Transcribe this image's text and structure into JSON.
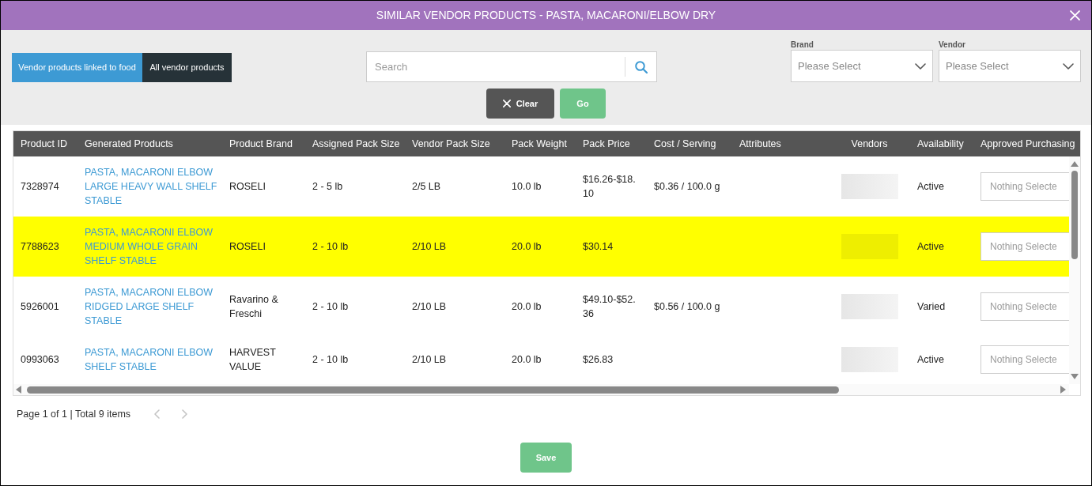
{
  "dialog": {
    "title": "SIMILAR VENDOR PRODUCTS - PASTA, MACARONI/ELBOW DRY"
  },
  "filters": {
    "tabs": [
      {
        "label": "Vendor products linked to food",
        "selected": true
      },
      {
        "label": "All vendor products",
        "selected": false
      }
    ],
    "search": {
      "placeholder": "Search"
    },
    "buttons": [
      {
        "label": "Clear",
        "kind": "clear"
      },
      {
        "label": "Go",
        "kind": "go"
      }
    ],
    "brand": {
      "label": "Brand",
      "placeholder": "Please Select"
    },
    "vendor": {
      "label": "Vendor",
      "placeholder": "Please Select"
    }
  },
  "table": {
    "columns": [
      "Product ID",
      "Generated Products",
      "Product Brand",
      "Assigned Pack Size",
      "Vendor Pack Size",
      "Pack Weight",
      "Pack Price",
      "Cost / Serving",
      "Attributes",
      "Vendors",
      "Availability",
      "Approved Purchasing"
    ],
    "rows": [
      {
        "highlighted": false,
        "product_id": "7328974",
        "generated_product": "PASTA, MACARONI ELBOW LARGE HEAVY WALL SHELF STABLE",
        "product_brand": "ROSELI",
        "assigned_pack_size": "2 - 5 lb",
        "vendor_pack_size": "2/5 LB",
        "pack_weight": "10.0 lb",
        "pack_price": "$16.26-$18.10",
        "cost_per_serving": "$0.36 / 100.0 g",
        "availability": "Active",
        "approved_purchasing": {
          "placeholder": "Nothing Selecte"
        }
      },
      {
        "highlighted": true,
        "product_id": "7788623",
        "generated_product": "PASTA, MACARONI ELBOW MEDIUM WHOLE GRAIN SHELF STABLE",
        "product_brand": "ROSELI",
        "assigned_pack_size": "2 - 10 lb",
        "vendor_pack_size": "2/10 LB",
        "pack_weight": "20.0 lb",
        "pack_price": "$30.14",
        "availability": "Active",
        "approved_purchasing": {
          "placeholder": "Nothing Selecte"
        }
      },
      {
        "highlighted": false,
        "product_id": "5926001",
        "generated_product": "PASTA, MACARONI ELBOW RIDGED LARGE SHELF STABLE",
        "product_brand": "Ravarino & Freschi",
        "assigned_pack_size": "2 - 10 lb",
        "vendor_pack_size": "2/10 LB",
        "pack_weight": "20.0 lb",
        "pack_price": "$49.10-$52.36",
        "cost_per_serving": "$0.56 / 100.0 g",
        "availability": "Varied",
        "approved_purchasing": {
          "placeholder": "Nothing Selecte"
        }
      },
      {
        "highlighted": false,
        "product_id": "0993063",
        "generated_product": "PASTA, MACARONI ELBOW SHELF STABLE",
        "product_brand": "HARVEST VALUE",
        "assigned_pack_size": "2 - 10 lb",
        "vendor_pack_size": "2/10 LB",
        "pack_weight": "20.0 lb",
        "pack_price": "$26.83",
        "availability": "Active",
        "approved_purchasing": {
          "placeholder": "Nothing Selecte"
        }
      }
    ]
  },
  "pagination": {
    "summary": "Page 1 of 1 | Total 9 items",
    "previous": {
      "disabled": true
    },
    "next": {
      "disabled": true
    }
  },
  "footer": {
    "save_button": "Save"
  }
}
